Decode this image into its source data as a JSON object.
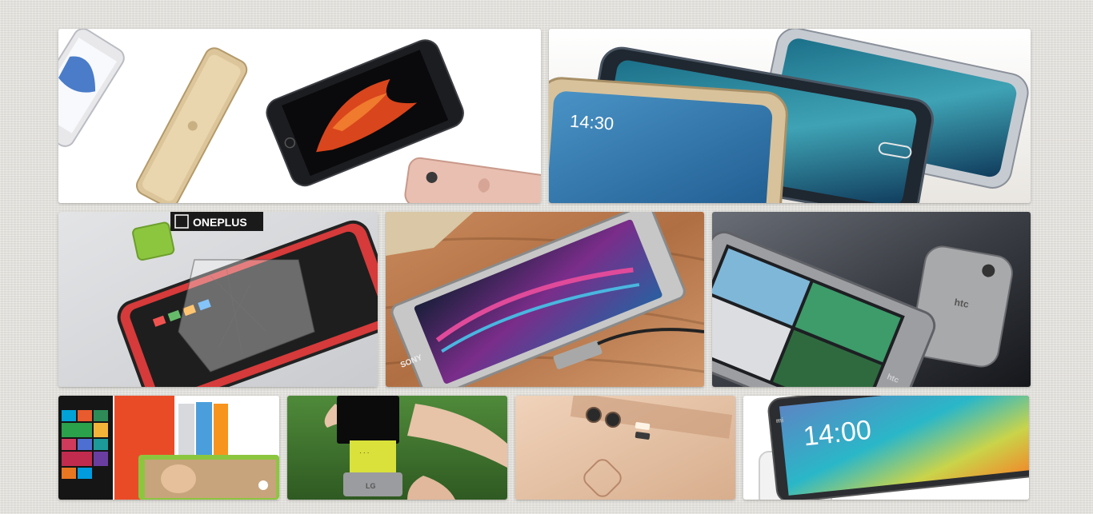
{
  "gallery": {
    "tiles": [
      {
        "id": "iphone-6s",
        "background": "#ffffff"
      },
      {
        "id": "galaxy-s6-edge",
        "background": "#f4f2ee"
      },
      {
        "id": "oneplus",
        "brand_label": "ONEPLUS",
        "background": "#d9dadc"
      },
      {
        "id": "xperia",
        "brand_label": "SONY",
        "background": "#b8774a"
      },
      {
        "id": "htc-one",
        "brand_label": "htc",
        "background": "#2a2d33"
      },
      {
        "id": "lumia",
        "background": "#ffffff"
      },
      {
        "id": "lg-g5",
        "brand_label": "LG",
        "background": "#3d6b2e"
      },
      {
        "id": "huawei-p9",
        "background": "#e4c2a7"
      },
      {
        "id": "mi-note",
        "clock_label": "14:00",
        "brand_label": "mi",
        "background": "#ffffff"
      }
    ]
  }
}
